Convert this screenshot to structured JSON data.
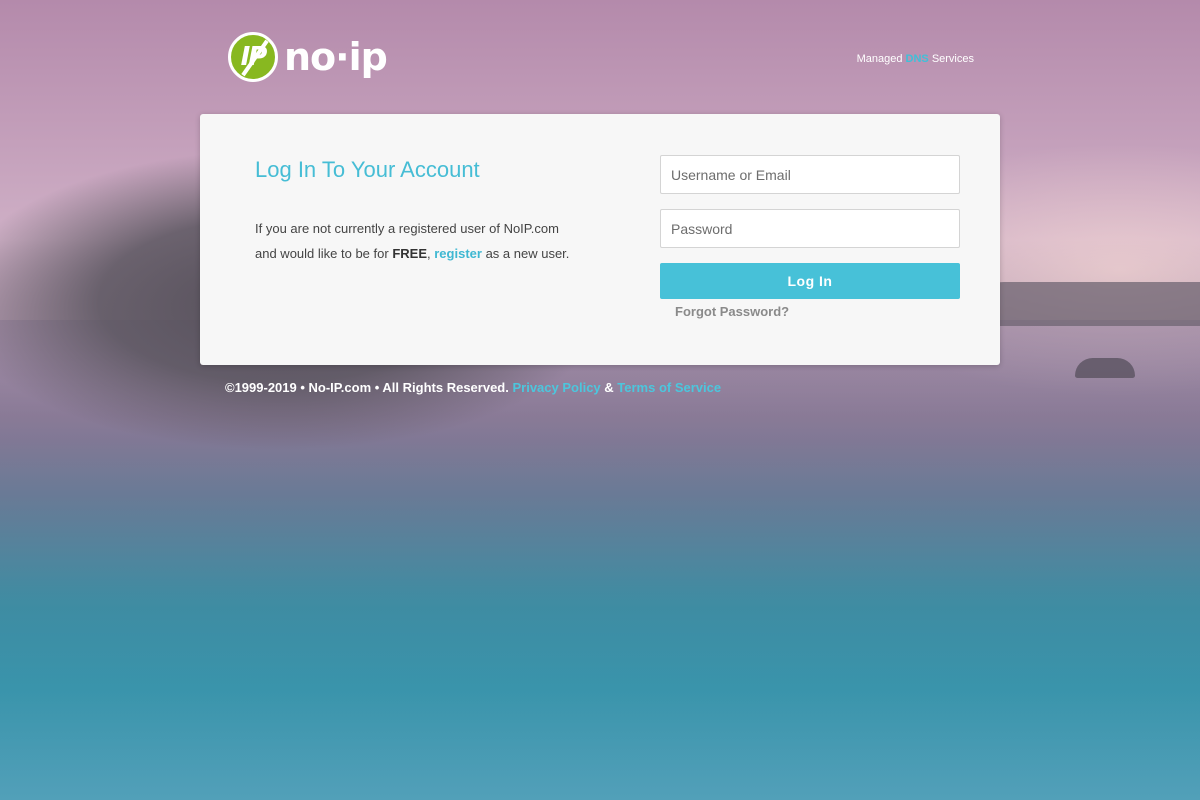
{
  "header": {
    "logo_text": "no·ip",
    "logo_badge": "IP",
    "tagline_prefix": "Managed",
    "tagline_highlight": "DNS",
    "tagline_suffix": "Services"
  },
  "login": {
    "title": "Log In To Your Account",
    "desc_line1": "If you are not currently a registered user of NoIP.com",
    "desc_line2_prefix": "and would like to be for",
    "desc_free": "FREE",
    "desc_comma": ",",
    "register_link": "register",
    "desc_suffix": "as a new user.",
    "username_placeholder": "Username or Email",
    "username_value": "",
    "password_placeholder": "Password",
    "password_value": "",
    "login_button": "Log In",
    "forgot_link": "Forgot Password?"
  },
  "footer": {
    "copyright": "©1999-2019 • No-IP.com • All Rights Reserved.",
    "privacy_link": "Privacy Policy",
    "amp": "&",
    "terms_link": "Terms of Service"
  },
  "colors": {
    "accent": "#47c1d8",
    "logo_green": "#88b820",
    "card_bg": "#f7f7f7"
  },
  "icons": [
    "no-ip-logo-icon"
  ]
}
